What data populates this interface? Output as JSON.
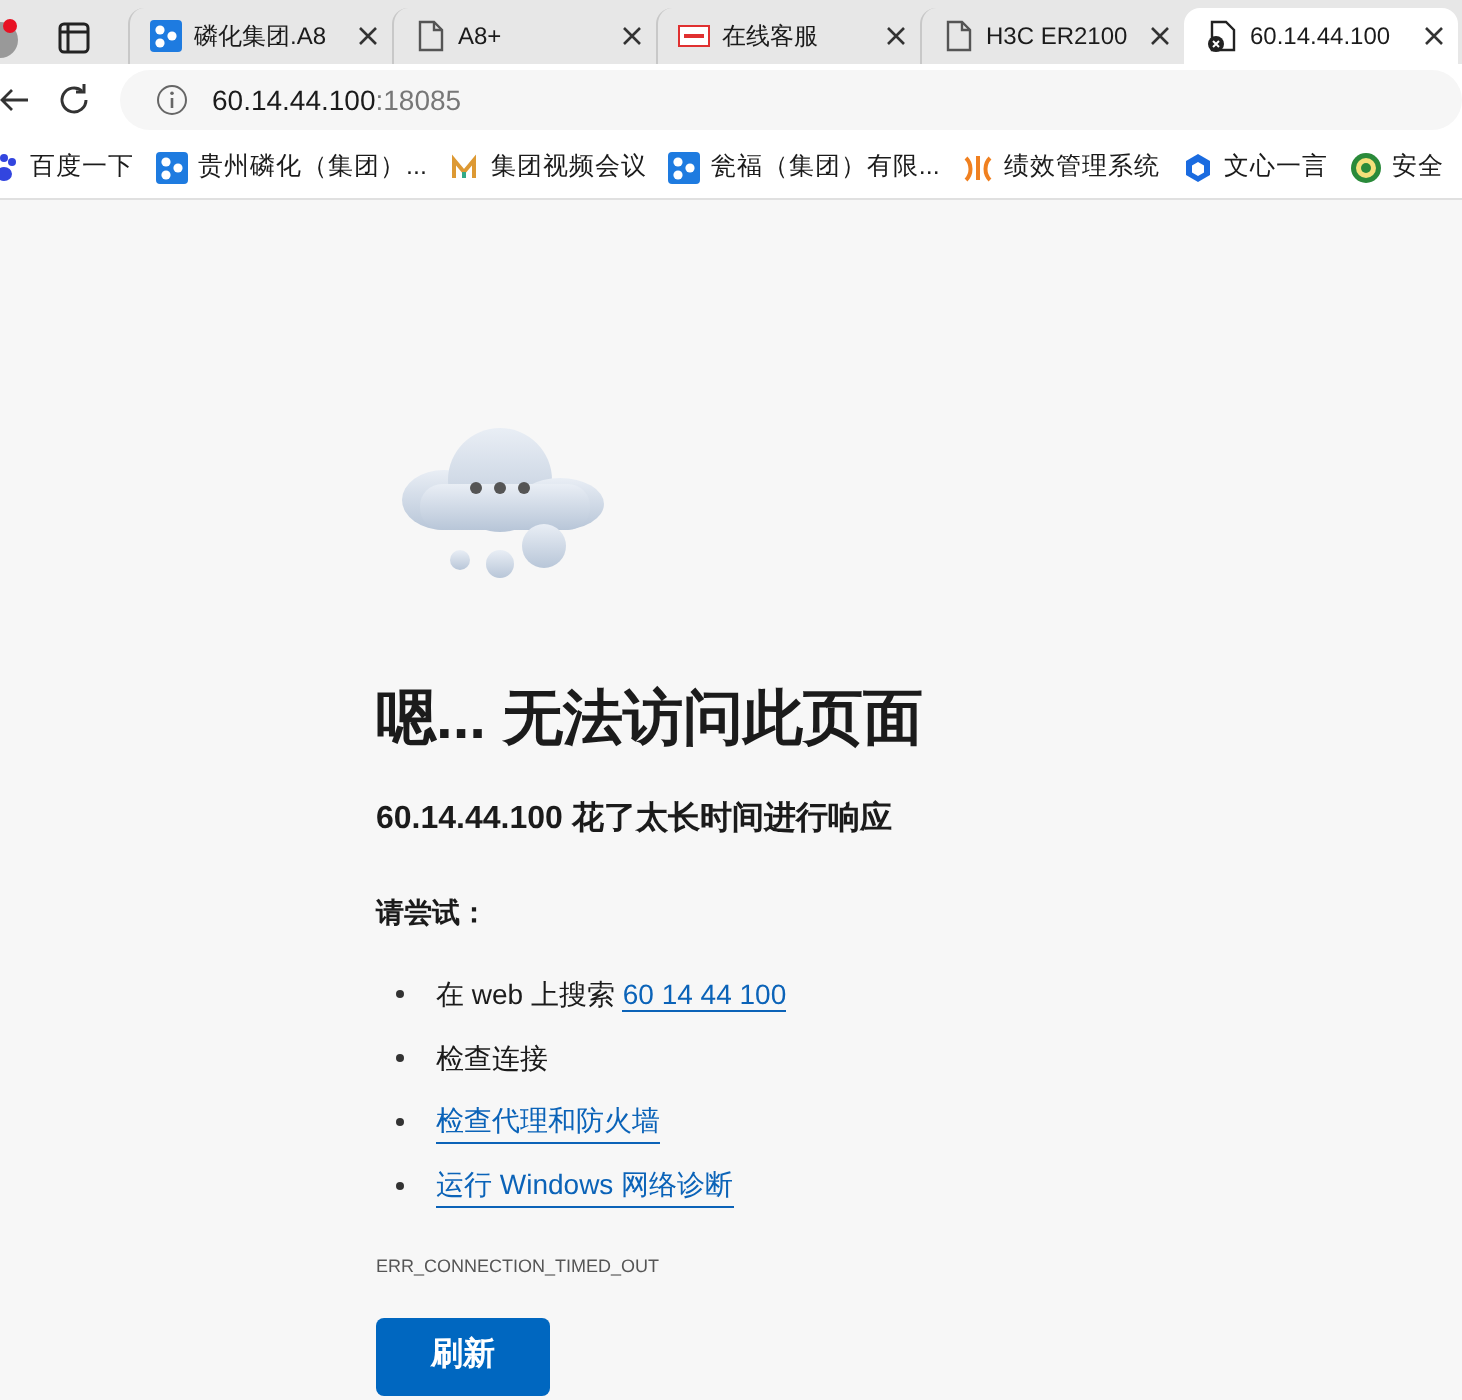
{
  "tabs": [
    {
      "label": "磷化集团.A8",
      "selected": false
    },
    {
      "label": "A8+",
      "selected": false
    },
    {
      "label": "在线客服",
      "selected": false
    },
    {
      "label": "H3C ER2100",
      "selected": false
    },
    {
      "label": "60.14.44.100",
      "selected": true
    }
  ],
  "address": {
    "host": "60.14.44.100",
    "port": ":18085"
  },
  "bookmarks": [
    {
      "label": "百度一下"
    },
    {
      "label": "贵州磷化（集团）..."
    },
    {
      "label": "集团视频会议"
    },
    {
      "label": "瓮福（集团）有限..."
    },
    {
      "label": "绩效管理系统"
    },
    {
      "label": "文心一言"
    },
    {
      "label": "安全"
    }
  ],
  "error_page": {
    "title": "嗯... 无法访问此页面",
    "subtitle": "60.14.44.100 花了太长时间进行响应",
    "try_heading": "请尝试：",
    "suggestions": [
      {
        "text": "在 web 上搜索 ",
        "link": "60 14 44 100"
      },
      {
        "text": "检查连接"
      },
      {
        "link": "检查代理和防火墙"
      },
      {
        "link": "运行 Windows 网络诊断"
      }
    ],
    "error_code": "ERR_CONNECTION_TIMED_OUT",
    "button": "刷新"
  }
}
